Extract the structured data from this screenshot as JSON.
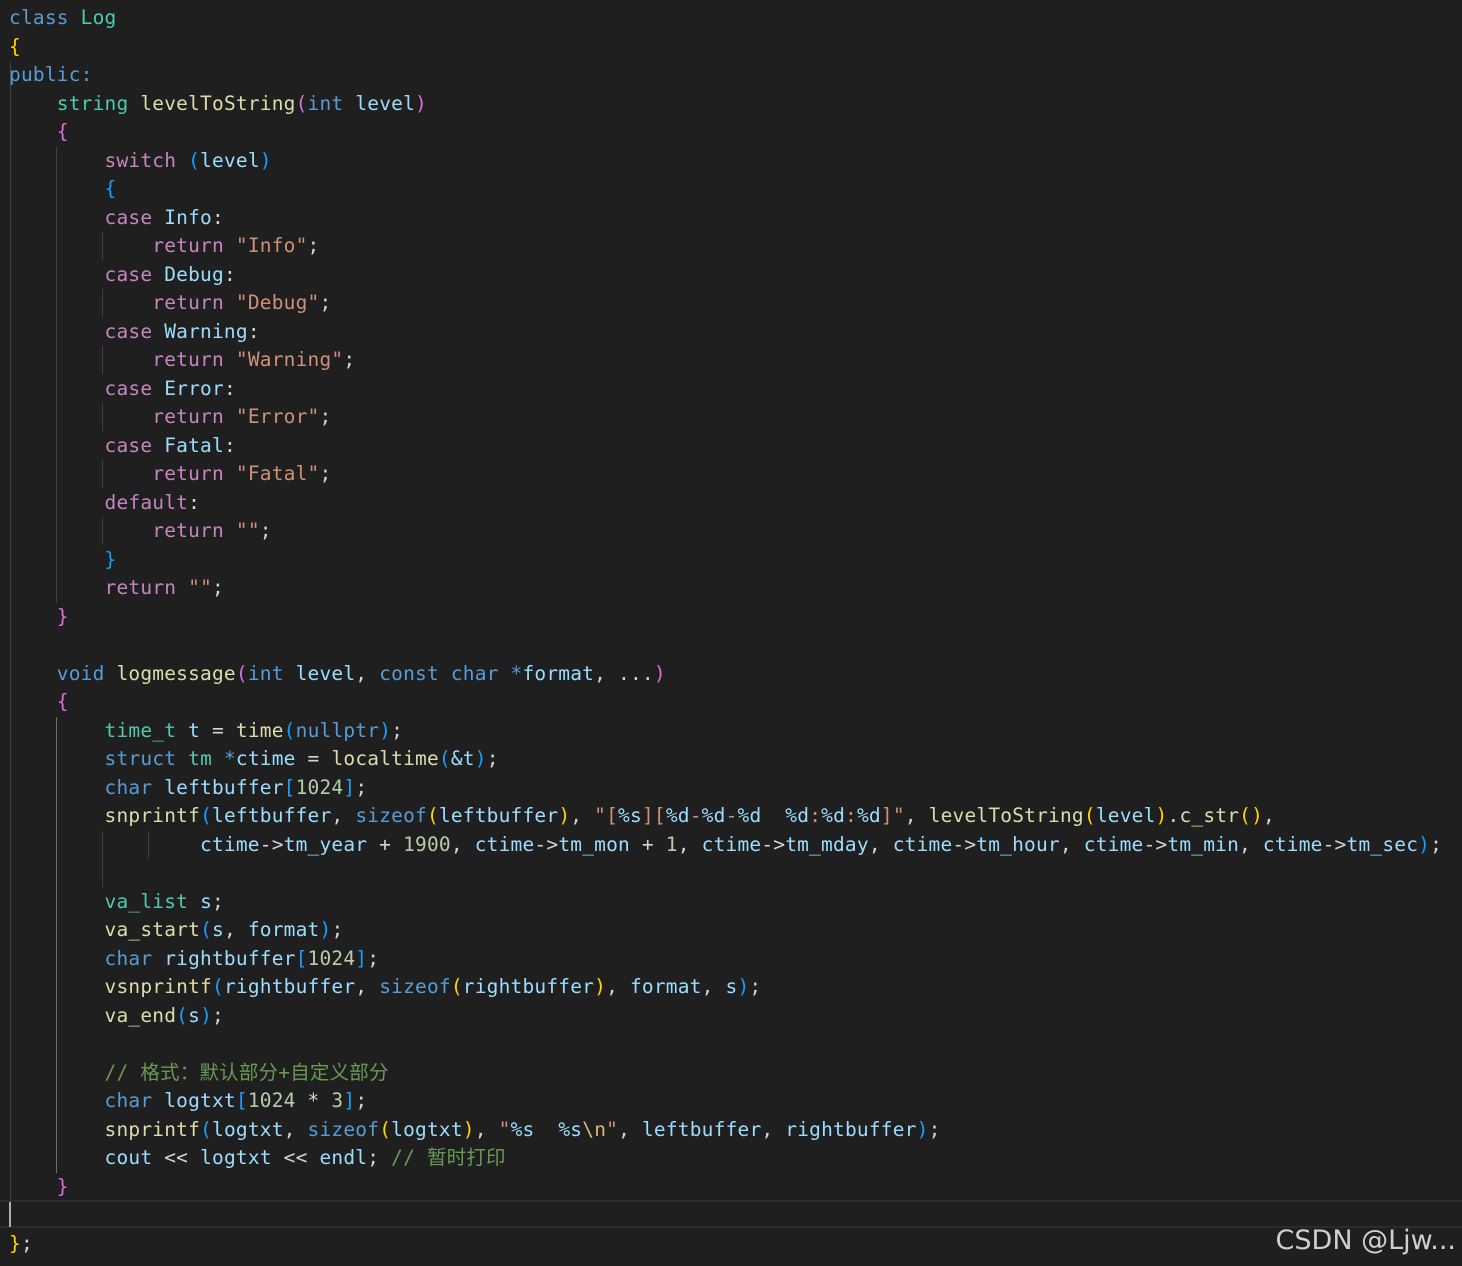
{
  "colors": {
    "background": "#1f1f1f",
    "default": "#d4d4d4",
    "keyword": "#569cd6",
    "control": "#c586c0",
    "type": "#4ec9b0",
    "function": "#dcdcaa",
    "variable": "#9cdcfe",
    "string": "#ce9178",
    "number": "#b5cea8",
    "comment": "#6a9955",
    "escape": "#d7ba7d",
    "bracket_gold": "#ffd700",
    "bracket_pink": "#da70d6",
    "bracket_blue": "#179fff"
  },
  "watermark": "CSDN @Ljw...",
  "code_lines": [
    [
      [
        "class ",
        "keyword"
      ],
      [
        "Log",
        "type"
      ]
    ],
    [
      [
        "{",
        "bracket_gold"
      ]
    ],
    [
      [
        "public:",
        "keyword"
      ]
    ],
    [
      [
        "    "
      ],
      [
        "string ",
        "type"
      ],
      [
        "levelToString",
        "function"
      ],
      [
        "(",
        "bracket_pink"
      ],
      [
        "int ",
        "keyword"
      ],
      [
        "level",
        "variable"
      ],
      [
        ")",
        "bracket_pink"
      ]
    ],
    [
      [
        "    "
      ],
      [
        "{",
        "bracket_pink"
      ]
    ],
    [
      [
        "        "
      ],
      [
        "switch ",
        "control"
      ],
      [
        "(",
        "bracket_blue"
      ],
      [
        "level",
        "variable"
      ],
      [
        ")",
        "bracket_blue"
      ]
    ],
    [
      [
        "        "
      ],
      [
        "{",
        "bracket_blue"
      ]
    ],
    [
      [
        "        "
      ],
      [
        "case ",
        "control"
      ],
      [
        "Info",
        "variable"
      ],
      [
        ":"
      ]
    ],
    [
      [
        "            "
      ],
      [
        "return ",
        "control"
      ],
      [
        "\"Info\"",
        "string"
      ],
      [
        ";"
      ]
    ],
    [
      [
        "        "
      ],
      [
        "case ",
        "control"
      ],
      [
        "Debug",
        "variable"
      ],
      [
        ":"
      ]
    ],
    [
      [
        "            "
      ],
      [
        "return ",
        "control"
      ],
      [
        "\"Debug\"",
        "string"
      ],
      [
        ";"
      ]
    ],
    [
      [
        "        "
      ],
      [
        "case ",
        "control"
      ],
      [
        "Warning",
        "variable"
      ],
      [
        ":"
      ]
    ],
    [
      [
        "            "
      ],
      [
        "return ",
        "control"
      ],
      [
        "\"Warning\"",
        "string"
      ],
      [
        ";"
      ]
    ],
    [
      [
        "        "
      ],
      [
        "case ",
        "control"
      ],
      [
        "Error",
        "variable"
      ],
      [
        ":"
      ]
    ],
    [
      [
        "            "
      ],
      [
        "return ",
        "control"
      ],
      [
        "\"Error\"",
        "string"
      ],
      [
        ";"
      ]
    ],
    [
      [
        "        "
      ],
      [
        "case ",
        "control"
      ],
      [
        "Fatal",
        "variable"
      ],
      [
        ":"
      ]
    ],
    [
      [
        "            "
      ],
      [
        "return ",
        "control"
      ],
      [
        "\"Fatal\"",
        "string"
      ],
      [
        ";"
      ]
    ],
    [
      [
        "        "
      ],
      [
        "default",
        "control"
      ],
      [
        ":"
      ]
    ],
    [
      [
        "            "
      ],
      [
        "return ",
        "control"
      ],
      [
        "\"\"",
        "string"
      ],
      [
        ";"
      ]
    ],
    [
      [
        "        "
      ],
      [
        "}",
        "bracket_blue"
      ]
    ],
    [
      [
        "        "
      ],
      [
        "return ",
        "control"
      ],
      [
        "\"\"",
        "string"
      ],
      [
        ";"
      ]
    ],
    [
      [
        "    "
      ],
      [
        "}",
        "bracket_pink"
      ]
    ],
    [],
    [
      [
        "    "
      ],
      [
        "void ",
        "keyword"
      ],
      [
        "logmessage",
        "function"
      ],
      [
        "(",
        "bracket_pink"
      ],
      [
        "int ",
        "keyword"
      ],
      [
        "level",
        "variable"
      ],
      [
        ", "
      ],
      [
        "const ",
        "keyword"
      ],
      [
        "char ",
        "keyword"
      ],
      [
        "*",
        "keyword"
      ],
      [
        "format",
        "variable"
      ],
      [
        ", ...",
        ""
      ],
      [
        ")",
        "bracket_pink"
      ]
    ],
    [
      [
        "    "
      ],
      [
        "{",
        "bracket_pink"
      ]
    ],
    [
      [
        "        "
      ],
      [
        "time_t ",
        "type"
      ],
      [
        "t",
        "variable"
      ],
      [
        " = "
      ],
      [
        "time",
        "function"
      ],
      [
        "(",
        "bracket_blue"
      ],
      [
        "nullptr",
        "keyword"
      ],
      [
        ")",
        "bracket_blue"
      ],
      [
        ";"
      ]
    ],
    [
      [
        "        "
      ],
      [
        "struct ",
        "keyword"
      ],
      [
        "tm ",
        "type"
      ],
      [
        "*",
        "keyword"
      ],
      [
        "ctime",
        "variable"
      ],
      [
        " = "
      ],
      [
        "localtime",
        "function"
      ],
      [
        "(",
        "bracket_blue"
      ],
      [
        "&t",
        "variable"
      ],
      [
        ")",
        "bracket_blue"
      ],
      [
        ";"
      ]
    ],
    [
      [
        "        "
      ],
      [
        "char ",
        "keyword"
      ],
      [
        "leftbuffer",
        "variable"
      ],
      [
        "[",
        "bracket_blue"
      ],
      [
        "1024",
        "number"
      ],
      [
        "]",
        "bracket_blue"
      ],
      [
        ";"
      ]
    ],
    [
      [
        "        "
      ],
      [
        "snprintf",
        "function"
      ],
      [
        "(",
        "bracket_blue"
      ],
      [
        "leftbuffer",
        "variable"
      ],
      [
        ", "
      ],
      [
        "sizeof",
        "keyword"
      ],
      [
        "(",
        "bracket_gold"
      ],
      [
        "leftbuffer",
        "variable"
      ],
      [
        ")",
        "bracket_gold"
      ],
      [
        ", "
      ],
      [
        "\"[",
        "string"
      ],
      [
        "%s",
        "variable"
      ],
      [
        "][",
        "string"
      ],
      [
        "%d",
        "variable"
      ],
      [
        "-",
        "string"
      ],
      [
        "%d",
        "variable"
      ],
      [
        "-",
        "string"
      ],
      [
        "%d",
        "variable"
      ],
      [
        "  ",
        "string"
      ],
      [
        "%d",
        "variable"
      ],
      [
        ":",
        "string"
      ],
      [
        "%d",
        "variable"
      ],
      [
        ":",
        "string"
      ],
      [
        "%d",
        "variable"
      ],
      [
        "]\"",
        "string"
      ],
      [
        ", "
      ],
      [
        "levelToString",
        "function"
      ],
      [
        "(",
        "bracket_gold"
      ],
      [
        "level",
        "variable"
      ],
      [
        ")",
        "bracket_gold"
      ],
      [
        "."
      ],
      [
        "c_str",
        "function"
      ],
      [
        "()",
        "bracket_gold"
      ],
      [
        ","
      ]
    ],
    [
      [
        "                "
      ],
      [
        "ctime",
        "variable"
      ],
      [
        "->"
      ],
      [
        "tm_year",
        "variable"
      ],
      [
        " + "
      ],
      [
        "1900",
        "number"
      ],
      [
        ", "
      ],
      [
        "ctime",
        "variable"
      ],
      [
        "->"
      ],
      [
        "tm_mon",
        "variable"
      ],
      [
        " + "
      ],
      [
        "1",
        "number"
      ],
      [
        ", "
      ],
      [
        "ctime",
        "variable"
      ],
      [
        "->"
      ],
      [
        "tm_mday",
        "variable"
      ],
      [
        ", "
      ],
      [
        "ctime",
        "variable"
      ],
      [
        "->"
      ],
      [
        "tm_hour",
        "variable"
      ],
      [
        ", "
      ],
      [
        "ctime",
        "variable"
      ],
      [
        "->"
      ],
      [
        "tm_min",
        "variable"
      ],
      [
        ", "
      ],
      [
        "ctime",
        "variable"
      ],
      [
        "->"
      ],
      [
        "tm_sec",
        "variable"
      ],
      [
        ")",
        "bracket_blue"
      ],
      [
        ";"
      ]
    ],
    [],
    [
      [
        "        "
      ],
      [
        "va_list ",
        "type"
      ],
      [
        "s",
        "variable"
      ],
      [
        ";"
      ]
    ],
    [
      [
        "        "
      ],
      [
        "va_start",
        "function"
      ],
      [
        "(",
        "bracket_blue"
      ],
      [
        "s",
        "variable"
      ],
      [
        ", "
      ],
      [
        "format",
        "variable"
      ],
      [
        ")",
        "bracket_blue"
      ],
      [
        ";"
      ]
    ],
    [
      [
        "        "
      ],
      [
        "char ",
        "keyword"
      ],
      [
        "rightbuffer",
        "variable"
      ],
      [
        "[",
        "bracket_blue"
      ],
      [
        "1024",
        "number"
      ],
      [
        "]",
        "bracket_blue"
      ],
      [
        ";"
      ]
    ],
    [
      [
        "        "
      ],
      [
        "vsnprintf",
        "function"
      ],
      [
        "(",
        "bracket_blue"
      ],
      [
        "rightbuffer",
        "variable"
      ],
      [
        ", "
      ],
      [
        "sizeof",
        "keyword"
      ],
      [
        "(",
        "bracket_gold"
      ],
      [
        "rightbuffer",
        "variable"
      ],
      [
        ")",
        "bracket_gold"
      ],
      [
        ", "
      ],
      [
        "format",
        "variable"
      ],
      [
        ", "
      ],
      [
        "s",
        "variable"
      ],
      [
        ")",
        "bracket_blue"
      ],
      [
        ";"
      ]
    ],
    [
      [
        "        "
      ],
      [
        "va_end",
        "function"
      ],
      [
        "(",
        "bracket_blue"
      ],
      [
        "s",
        "variable"
      ],
      [
        ")",
        "bracket_blue"
      ],
      [
        ";"
      ]
    ],
    [],
    [
      [
        "        "
      ],
      [
        "// 格式：默认部分+自定义部分",
        "comment"
      ]
    ],
    [
      [
        "        "
      ],
      [
        "char ",
        "keyword"
      ],
      [
        "logtxt",
        "variable"
      ],
      [
        "[",
        "bracket_blue"
      ],
      [
        "1024",
        "number"
      ],
      [
        " * "
      ],
      [
        "3",
        "number"
      ],
      [
        "]",
        "bracket_blue"
      ],
      [
        ";"
      ]
    ],
    [
      [
        "        "
      ],
      [
        "snprintf",
        "function"
      ],
      [
        "(",
        "bracket_blue"
      ],
      [
        "logtxt",
        "variable"
      ],
      [
        ", "
      ],
      [
        "sizeof",
        "keyword"
      ],
      [
        "(",
        "bracket_gold"
      ],
      [
        "logtxt",
        "variable"
      ],
      [
        ")",
        "bracket_gold"
      ],
      [
        ", "
      ],
      [
        "\"",
        "string"
      ],
      [
        "%s",
        "variable"
      ],
      [
        "  ",
        "string"
      ],
      [
        "%s",
        "variable"
      ],
      [
        "\\n",
        "escape"
      ],
      [
        "\"",
        "string"
      ],
      [
        ", "
      ],
      [
        "leftbuffer",
        "variable"
      ],
      [
        ", "
      ],
      [
        "rightbuffer",
        "variable"
      ],
      [
        ")",
        "bracket_blue"
      ],
      [
        ";"
      ]
    ],
    [
      [
        "        "
      ],
      [
        "cout",
        "variable"
      ],
      [
        " << "
      ],
      [
        "logtxt",
        "variable"
      ],
      [
        " << "
      ],
      [
        "endl",
        "variable"
      ],
      [
        "; "
      ],
      [
        "// 暂时打印",
        "comment"
      ]
    ],
    [
      [
        "    "
      ],
      [
        "}",
        "bracket_pink"
      ]
    ],
    [],
    [
      [
        "}",
        "bracket_gold"
      ],
      [
        ";"
      ]
    ]
  ]
}
